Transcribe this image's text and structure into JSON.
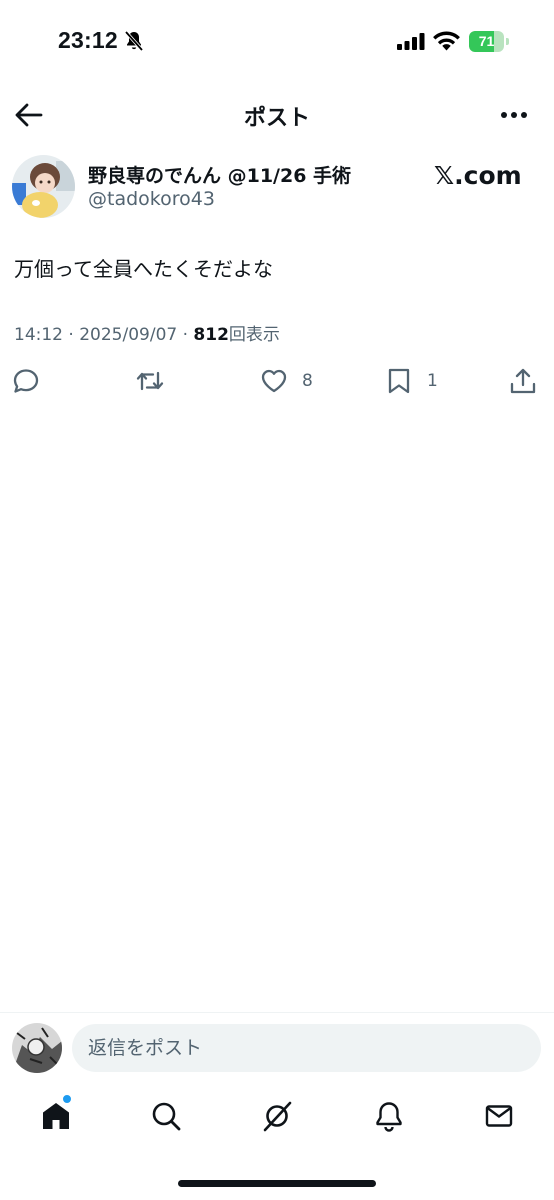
{
  "status_bar": {
    "time": "23:12",
    "battery_level": "71",
    "battery_fraction": 0.71,
    "icons": [
      "bell-slash-icon",
      "signal-icon",
      "wifi-icon",
      "battery-icon"
    ]
  },
  "nav": {
    "title": "ポスト",
    "back_icon": "arrow-left-icon",
    "more_icon": "more-horizontal-icon"
  },
  "post": {
    "author_name": "野良専のでんん @11/26 手術",
    "handle": "@tadokoro43",
    "watermark": "𝕏.com",
    "text": "万個って全員へたくそだよな",
    "time": "14:12",
    "date": "2025/09/07",
    "separator": "·",
    "views_count": "812",
    "views_label": "回表示",
    "actions": {
      "reply_count": "",
      "repost_count": "",
      "like_count": "8",
      "bookmark_count": "1"
    }
  },
  "reply_bar": {
    "placeholder": "返信をポスト"
  },
  "tabbar": {
    "items": [
      "home-icon",
      "search-icon",
      "grok-icon",
      "bell-icon",
      "mail-icon"
    ]
  },
  "colors": {
    "text": "#0f1419",
    "secondary": "#536471",
    "accent": "#1d9bf0",
    "battery": "#34c759"
  }
}
